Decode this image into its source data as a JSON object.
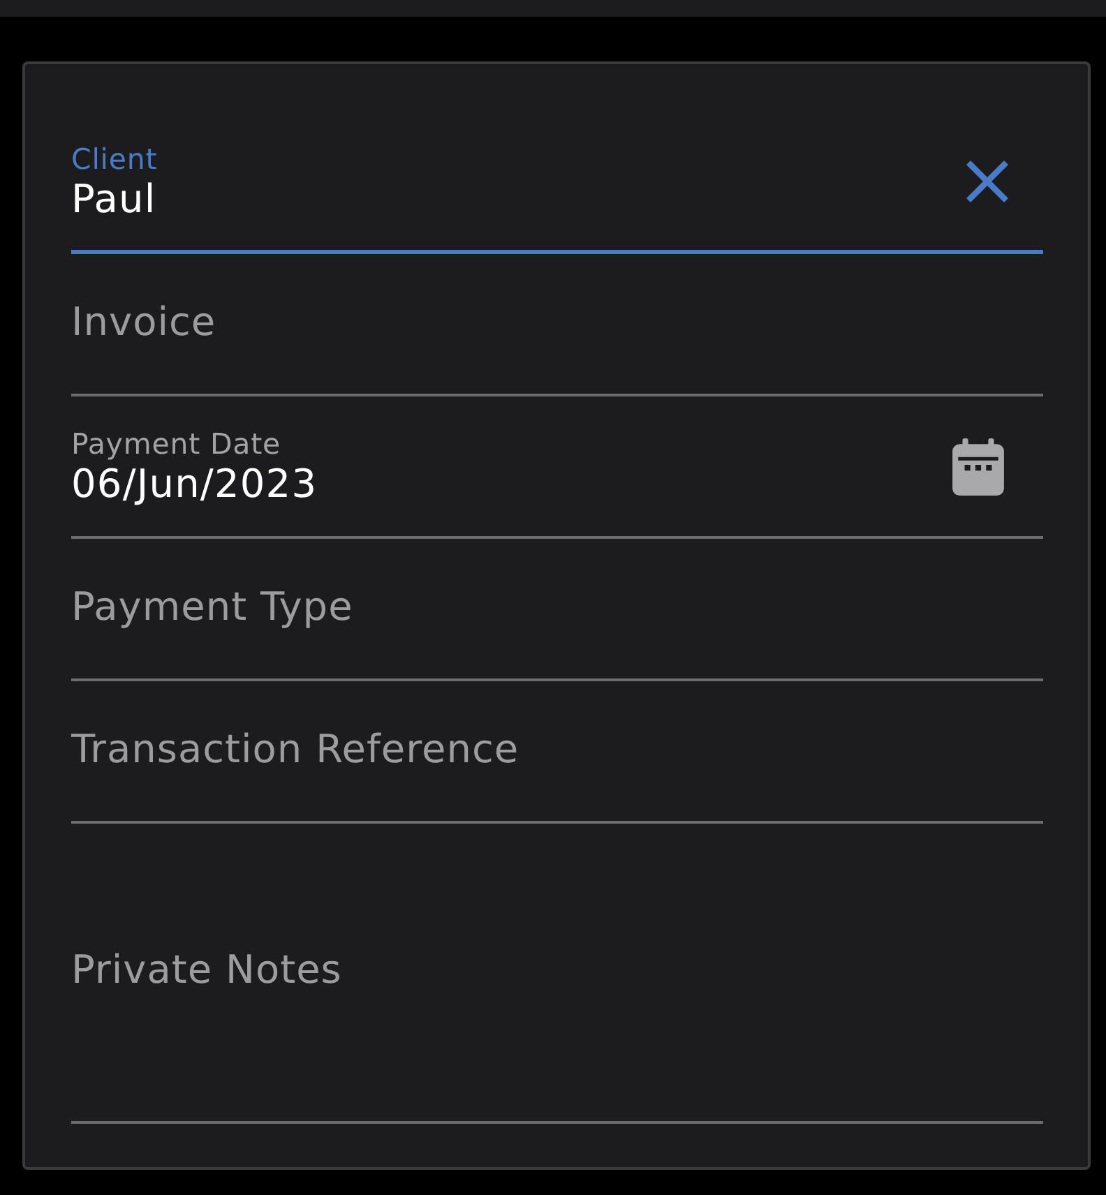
{
  "fields": [
    {
      "kind": "autocomplete",
      "label": "Client",
      "value": "Paul",
      "focused": true
    },
    {
      "kind": "text",
      "label": "Invoice",
      "focused": false
    },
    {
      "kind": "date",
      "label": "Payment Date",
      "value": "06/Jun/2023",
      "focused": false
    },
    {
      "kind": "text",
      "label": "Payment Type",
      "focused": false
    },
    {
      "kind": "text",
      "label": "Transaction Reference",
      "focused": false
    },
    {
      "kind": "textarea",
      "label": "Private Notes",
      "focused": false
    }
  ]
}
